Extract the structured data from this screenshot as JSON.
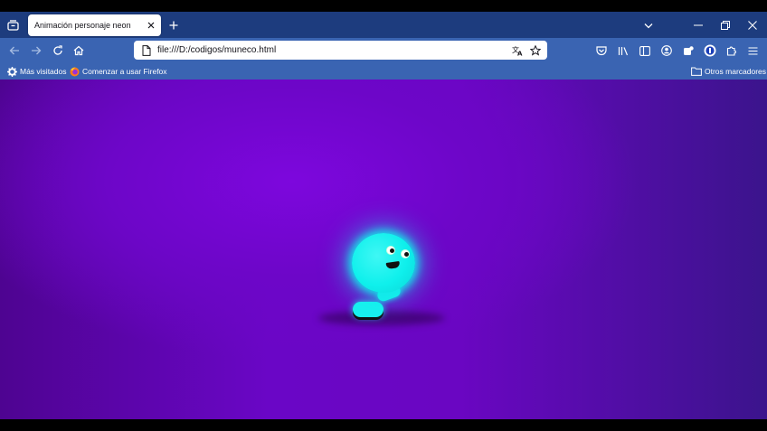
{
  "browser": {
    "tab": {
      "title": "Animación personaje neon"
    },
    "url": "file:///D:/codigos/muneco.html",
    "bookmarks": {
      "most_visited": "Más visitados",
      "get_started": "Comenzar a usar Firefox",
      "other": "Otros marcadores"
    }
  },
  "icons": {
    "tab_list": "tab-list-icon",
    "close_tab": "close-icon",
    "new_tab": "plus-icon",
    "back": "arrow-left-icon",
    "forward": "arrow-right-icon",
    "reload": "reload-icon",
    "home": "home-icon",
    "page": "page-icon",
    "translate": "translate-icon",
    "bookmark_star": "star-icon",
    "pocket": "pocket-icon",
    "library": "library-icon",
    "sidebar": "sidebar-icon",
    "account": "account-icon",
    "extensions": "puzzle-icon",
    "menu": "hamburger-icon"
  },
  "colors": {
    "tabstrip": "#1d3c7e",
    "toolbar": "#3a64b2",
    "page_purple": "#7d07dd",
    "neon_cyan": "#12e9ea"
  }
}
